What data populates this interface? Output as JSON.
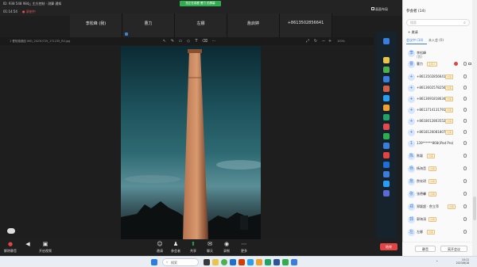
{
  "topbar": {
    "meeting_id": "ID: 938 548 984",
    "meeting_info": "△ 主方控制 · 测算 通知",
    "timer": "01:14:54",
    "record": "● 录制中",
    "share_banner": "您正在观看 曹力 的屏幕",
    "layout_label": "画面布局"
  },
  "participant_tiles": [
    "李松峰 (我)",
    "曹力",
    "左娜",
    "詹启婷",
    "+8613502856641"
  ],
  "share_toolbar": {
    "filename": "1 曹阳路烟囱 IMG_20230729_171235_RS.jpg",
    "zoom": "100%"
  },
  "toolbar": {
    "mute": "解除静音",
    "video": "开启视频",
    "invite": "邀请",
    "participants": "参会者",
    "share": "共享",
    "chat": "聊天",
    "record": "录制",
    "more": "更多",
    "end": "结束"
  },
  "panel": {
    "title": "参会者 (14)",
    "search_placeholder": "搜索",
    "invite": "邀请",
    "tab_in_meeting": "会议中 (14)",
    "tab_not_joined": "未入会 (0)",
    "host_badge": "主持人",
    "guest_badge": "访客",
    "participants": [
      {
        "name": "李松峰",
        "sub": "(我)",
        "avatar": "李"
      },
      {
        "name": "曹力",
        "avatar": "曹"
      },
      {
        "name": "+8613502856641",
        "avatar": "+"
      },
      {
        "name": "+8613602578256",
        "avatar": "+"
      },
      {
        "name": "+8613691818634",
        "avatar": "+"
      },
      {
        "name": "+8613714131791",
        "avatar": "+"
      },
      {
        "name": "+8618012863552",
        "avatar": "+"
      },
      {
        "name": "+8618126081807",
        "avatar": "+"
      },
      {
        "name": "139******868(iPad Pro)",
        "avatar": "1"
      },
      {
        "name": "陈颖",
        "avatar": "陈"
      },
      {
        "name": "杨海音",
        "avatar": "杨"
      },
      {
        "name": "詹钦玥",
        "avatar": "詹"
      },
      {
        "name": "张德馨",
        "avatar": "张"
      },
      {
        "name": "郑颖超 · 詹立萍",
        "avatar": "郑"
      },
      {
        "name": "郭海涛",
        "avatar": "郭"
      },
      {
        "name": "左娜",
        "avatar": "左"
      }
    ],
    "footer_mute": "静音",
    "footer_leave": "离开会议"
  },
  "taskbar": {
    "search_placeholder": "搜索",
    "time": "10:11",
    "date": "2023/8/18"
  },
  "colors": {
    "accent": "#3b7ddd",
    "share_banner": "#2fae50",
    "end_button": "#e24343"
  }
}
